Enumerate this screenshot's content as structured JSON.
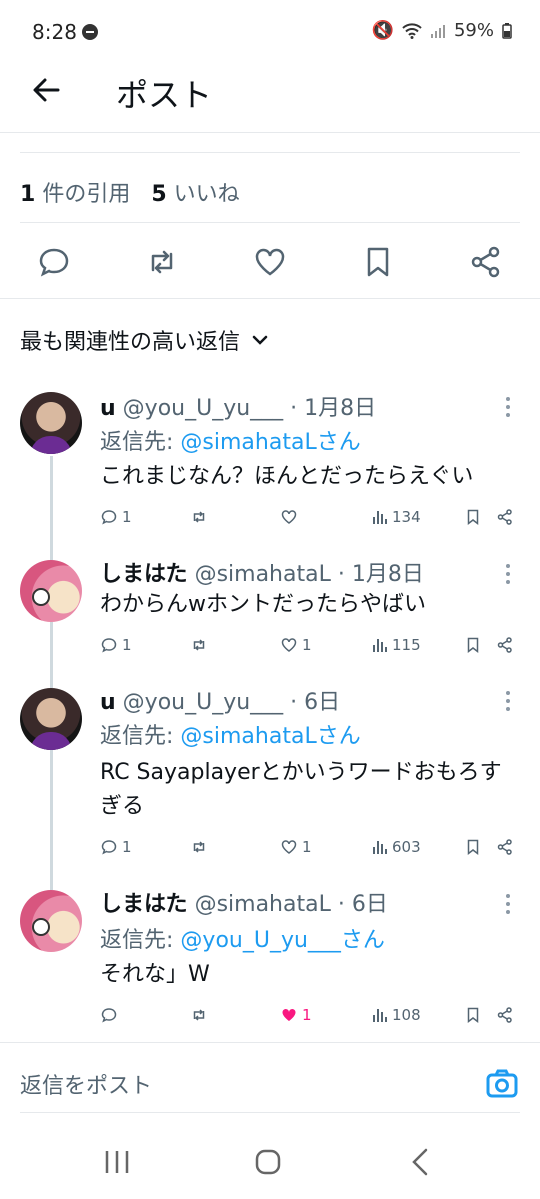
{
  "status": {
    "time": "8:28",
    "battery": "59%"
  },
  "header": {
    "title": "ポスト"
  },
  "stats": {
    "quotes_count": "1",
    "quotes_label": "件の引用",
    "likes_count": "5",
    "likes_label": "いいね"
  },
  "sort": {
    "label": "最も関連性の高い返信"
  },
  "replies": [
    {
      "name": "u",
      "handle": "@you_U_yu___",
      "date": "· 1月8日",
      "reply_to_label": "返信先:",
      "reply_to": "@simahataLさん",
      "text": "これまじなん？ほんとだったらえぐい",
      "replies": "1",
      "likes": "",
      "views": "134",
      "liked": false
    },
    {
      "name": "しまはた",
      "handle": "@simahataL",
      "date": "· 1月8日",
      "reply_to_label": "",
      "reply_to": "",
      "text": "わからんwホントだったらやばい",
      "replies": "1",
      "likes": "1",
      "views": "115",
      "liked": false
    },
    {
      "name": "u",
      "handle": "@you_U_yu___",
      "date": "· 6日",
      "reply_to_label": "返信先:",
      "reply_to": "@simahataLさん",
      "text": "RC Sayaplayerとかいうワードおもろすぎる",
      "replies": "1",
      "likes": "1",
      "views": "603",
      "liked": false
    },
    {
      "name": "しまはた",
      "handle": "@simahataL",
      "date": "· 6日",
      "reply_to_label": "返信先:",
      "reply_to": "@you_U_yu___さん",
      "text": "それな」W",
      "replies": "",
      "likes": "1",
      "views": "108",
      "liked": true
    }
  ],
  "composer": {
    "placeholder": "返信をポスト"
  },
  "colors": {
    "accent": "#1d9bf0",
    "like": "#f91880",
    "muted": "#536471"
  }
}
